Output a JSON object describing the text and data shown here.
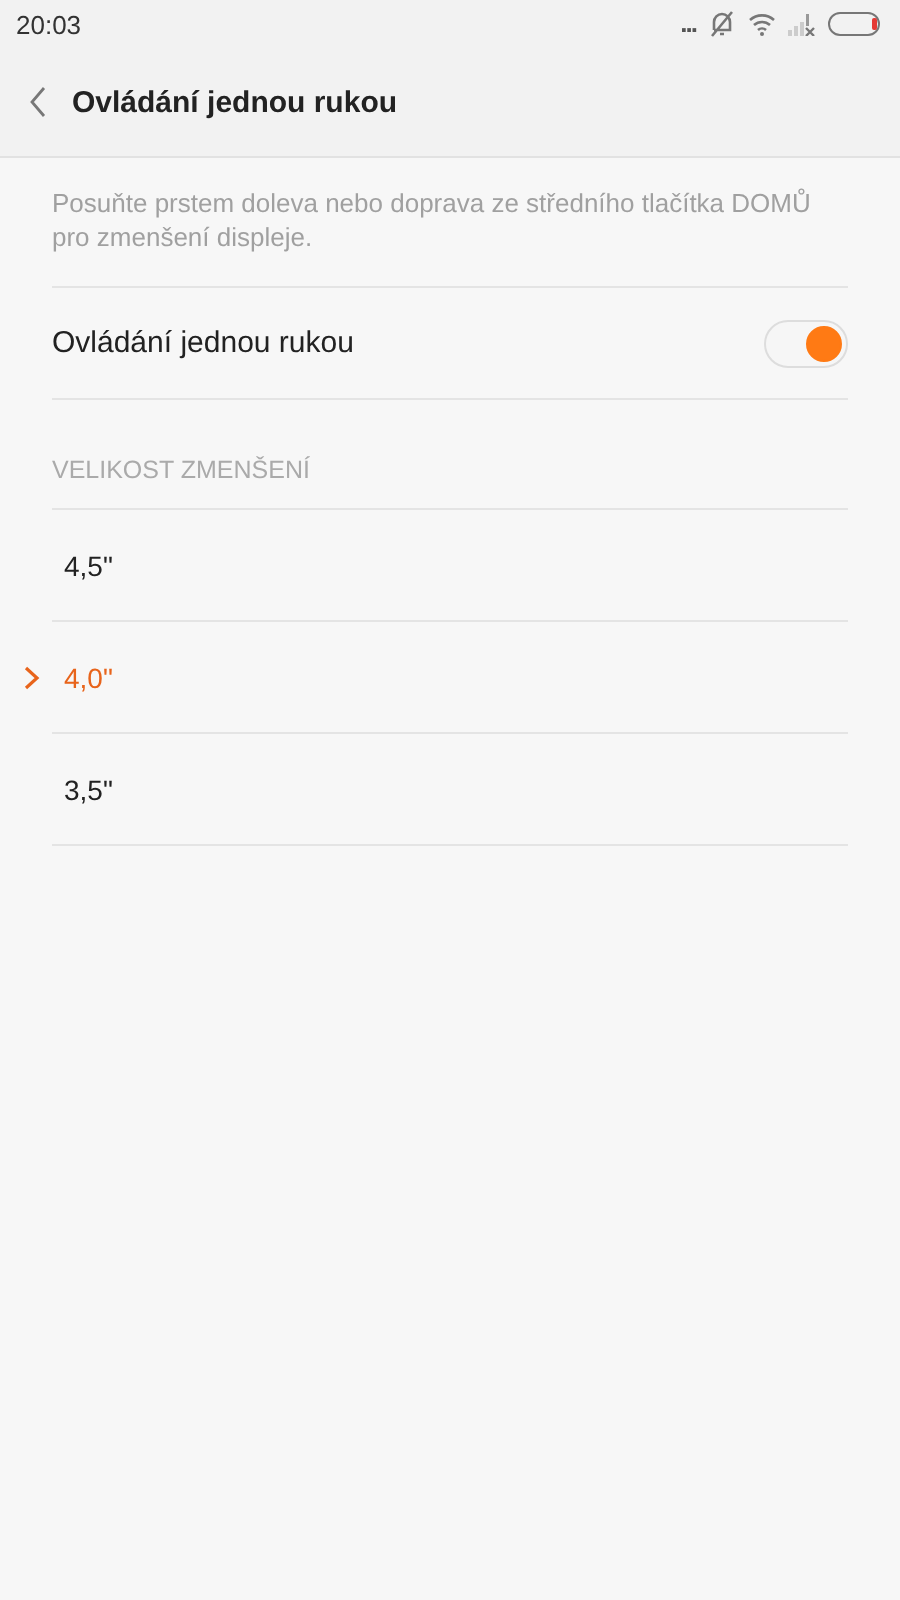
{
  "status_bar": {
    "time": "20:03",
    "more": "..."
  },
  "header": {
    "title": "Ovládání jednou rukou"
  },
  "description": "Posuňte prstem doleva nebo doprava ze středního tlačítka DOMŮ pro zmenšení displeje.",
  "toggle": {
    "label": "Ovládání jednou rukou",
    "on": true
  },
  "section": {
    "title": "VELIKOST ZMENŠENÍ"
  },
  "sizes": [
    {
      "label": "4,5\"",
      "selected": false
    },
    {
      "label": "4,0\"",
      "selected": true
    },
    {
      "label": "3,5\"",
      "selected": false
    }
  ]
}
